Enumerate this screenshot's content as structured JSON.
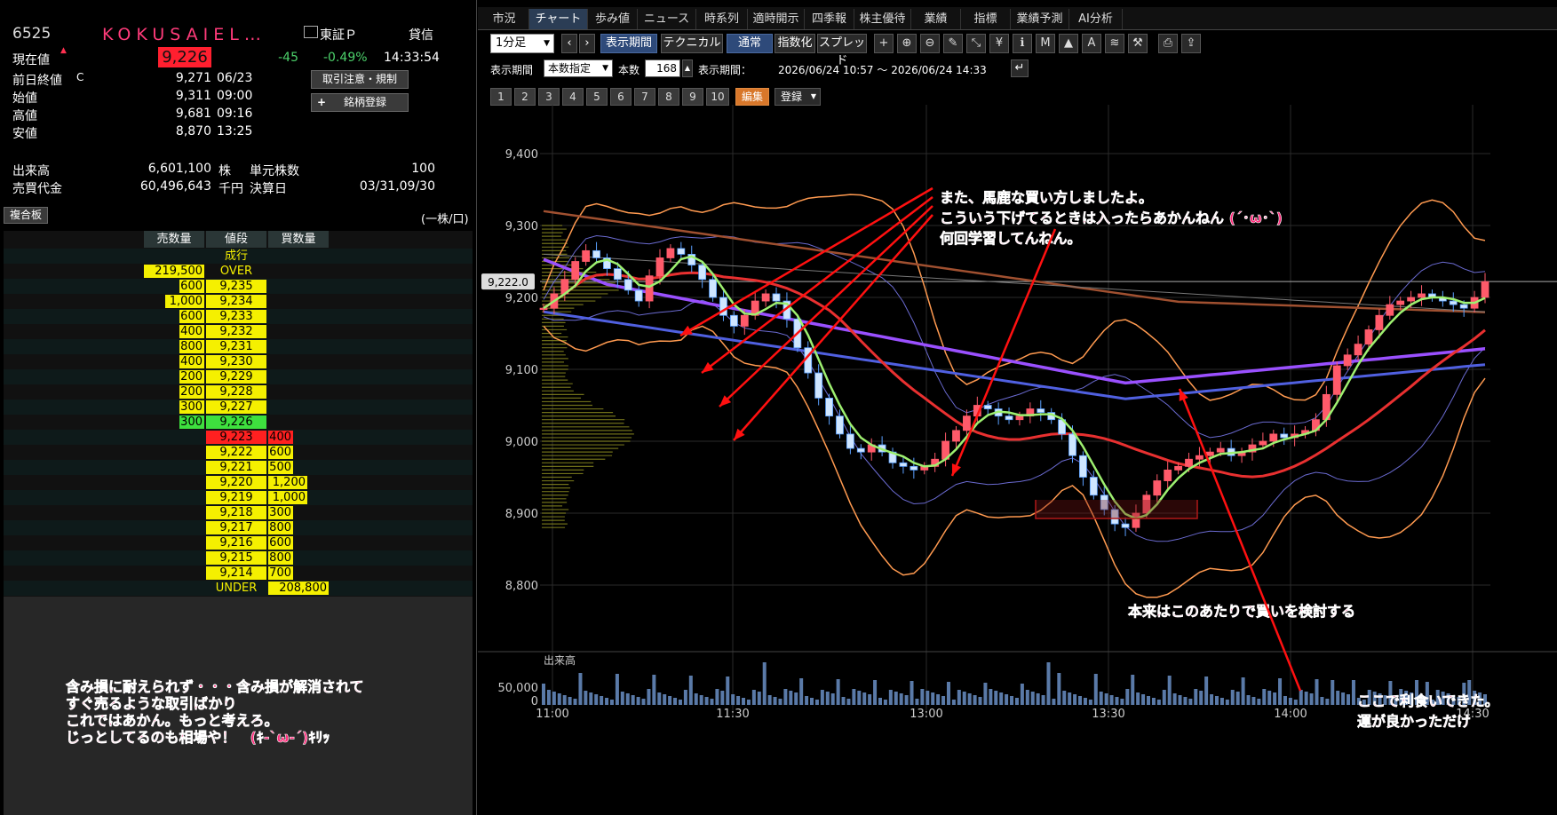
{
  "quote": {
    "code": "6525",
    "name": "KOKUSAIEL…",
    "market": "東証Ｐ",
    "credit": "貸信",
    "current_label": "現在値",
    "current_price": "9,226",
    "change": "-45",
    "change_pct": "-0.49%",
    "time": "14:33:54",
    "prev_close_label": "前日終値",
    "prev_close_flag": "C",
    "prev_close": "9,271",
    "prev_close_date": "06/23",
    "open_label": "始値",
    "open": "9,311",
    "open_time": "09:00",
    "high_label": "高値",
    "high": "9,681",
    "high_time": "09:16",
    "low_label": "安値",
    "low": "8,870",
    "low_time": "13:25",
    "volume_label": "出来高",
    "volume": "6,601,100",
    "volume_unit": "株",
    "unit_shares_label": "単元株数",
    "unit_shares": "100",
    "trading_value_label": "売買代金",
    "trading_value": "60,496,643",
    "trading_value_unit": "千円",
    "fiscal_label": "決算日",
    "fiscal": "03/31,09/30",
    "btn_regulation": "取引注意・規制",
    "btn_register": "銘柄登録",
    "btn_register_plus": "+"
  },
  "board": {
    "title": "複合板",
    "unit": "(一株/口)",
    "col_sell": "売数量",
    "col_price": "値段",
    "col_buy": "買数量",
    "rows": [
      {
        "sell": "",
        "price": "成行",
        "buy": ""
      },
      {
        "sell": "219,500",
        "price": "OVER",
        "buy": ""
      },
      {
        "sell": "600",
        "price": "9,235",
        "buy": ""
      },
      {
        "sell": "1,000",
        "price": "9,234",
        "buy": ""
      },
      {
        "sell": "600",
        "price": "9,233",
        "buy": ""
      },
      {
        "sell": "400",
        "price": "9,232",
        "buy": ""
      },
      {
        "sell": "800",
        "price": "9,231",
        "buy": ""
      },
      {
        "sell": "400",
        "price": "9,230",
        "buy": ""
      },
      {
        "sell": "200",
        "price": "9,229",
        "buy": ""
      },
      {
        "sell": "200",
        "price": "9,228",
        "buy": ""
      },
      {
        "sell": "300",
        "price": "9,227",
        "buy": ""
      },
      {
        "sell": "300",
        "price": "9,226",
        "buy": ""
      },
      {
        "sell": "",
        "price": "9,223",
        "buy": "400"
      },
      {
        "sell": "",
        "price": "9,222",
        "buy": "600"
      },
      {
        "sell": "",
        "price": "9,221",
        "buy": "500"
      },
      {
        "sell": "",
        "price": "9,220",
        "buy": "1,200"
      },
      {
        "sell": "",
        "price": "9,219",
        "buy": "1,000"
      },
      {
        "sell": "",
        "price": "9,218",
        "buy": "300"
      },
      {
        "sell": "",
        "price": "9,217",
        "buy": "800"
      },
      {
        "sell": "",
        "price": "9,216",
        "buy": "600"
      },
      {
        "sell": "",
        "price": "9,215",
        "buy": "800"
      },
      {
        "sell": "",
        "price": "9,214",
        "buy": "700"
      },
      {
        "sell": "",
        "price": "UNDER",
        "buy": "208,800"
      }
    ]
  },
  "memo": [
    "含み損に耐えられず・・・含み損が解消されて",
    "すぐ売るような取引ばかり",
    "これではあかん。もっと考えろ。",
    "じっとしてるのも相場や！　(ｷ-`ω-´)ｷﾘｯ"
  ],
  "tabs": [
    "市況",
    "チャート",
    "歩み値",
    "ニュース",
    "時系列",
    "適時開示",
    "四季報",
    "株主優待",
    "業績",
    "指標",
    "業績予測",
    "AI分析"
  ],
  "active_tab": "チャート",
  "toolbar": {
    "period_select": "1分足",
    "display_period": "表示期間",
    "technical": "テクニカル",
    "normal": "通常",
    "index": "指数化",
    "spread": "スプレッド",
    "period_label": "表示期間",
    "count_mode": "本数指定",
    "count_label": "本数",
    "count_value": "168",
    "range_label": "表示期間：",
    "range_value": "2026/06/24 10:57 〜 2026/06/24 14:33",
    "edit": "編集",
    "register": "登録",
    "presets": [
      "1",
      "2",
      "3",
      "4",
      "5",
      "6",
      "7",
      "8",
      "9",
      "10"
    ],
    "icons": [
      "crosshair-icon",
      "zoom-in-icon",
      "zoom-out-icon",
      "pen-icon",
      "draw-icon",
      "yen-icon",
      "info-icon",
      "indicator-icon",
      "mountain-icon",
      "auto-icon",
      "news-icon",
      "wrench-icon",
      "print-icon",
      "export-icon"
    ]
  },
  "chart_data": {
    "type": "candlestick",
    "yticks": [
      "9,400",
      "9,300",
      "9,200",
      "9,100",
      "9,000",
      "8,900",
      "8,800"
    ],
    "ylim": [
      8740,
      9460
    ],
    "xticks": [
      "11:00",
      "11:30",
      "13:00",
      "13:30",
      "14:00",
      "14:30"
    ],
    "last_price_tag": "9,222.0",
    "volume_label": "出来高",
    "volume_tick": "50,000",
    "volume_zero": "0",
    "price_path": [
      9185,
      9205,
      9225,
      9250,
      9265,
      9255,
      9240,
      9225,
      9210,
      9195,
      9230,
      9255,
      9268,
      9260,
      9245,
      9225,
      9200,
      9175,
      9160,
      9175,
      9195,
      9205,
      9195,
      9170,
      9130,
      9095,
      9060,
      9035,
      9010,
      8990,
      8985,
      8995,
      8985,
      8970,
      8965,
      8960,
      8965,
      8975,
      9000,
      9015,
      9035,
      9050,
      9045,
      9035,
      9030,
      9035,
      9045,
      9040,
      9030,
      9010,
      8980,
      8950,
      8925,
      8905,
      8885,
      8880,
      8900,
      8925,
      8945,
      8960,
      8965,
      8975,
      8980,
      8985,
      8990,
      8980,
      8985,
      8995,
      9000,
      9010,
      9005,
      9010,
      9015,
      9030,
      9065,
      9105,
      9120,
      9135,
      9155,
      9175,
      9190,
      9195,
      9200,
      9205,
      9200,
      9195,
      9190,
      9185,
      9200,
      9222
    ],
    "annotations": [
      "また、馬鹿な買い方しましたよ。",
      "こういう下げてるときは入ったらあかんねん (´･ω･`)",
      "何回学習してんねん。",
      "本来はこのあたりで買いを検討する",
      "ここで利食いできた。",
      "運が良かっただけ"
    ]
  },
  "colors": {
    "up": "#ff5a6a",
    "down": "#5aa0ff",
    "bollinger": "#ff9a50",
    "ma_short": "#9ef070",
    "ma_mid": "#e83030",
    "ma_long": "#9a50ff",
    "ma_200": "#a05030",
    "annotation": "#ff2a7a",
    "arrow": "#ff1010"
  }
}
